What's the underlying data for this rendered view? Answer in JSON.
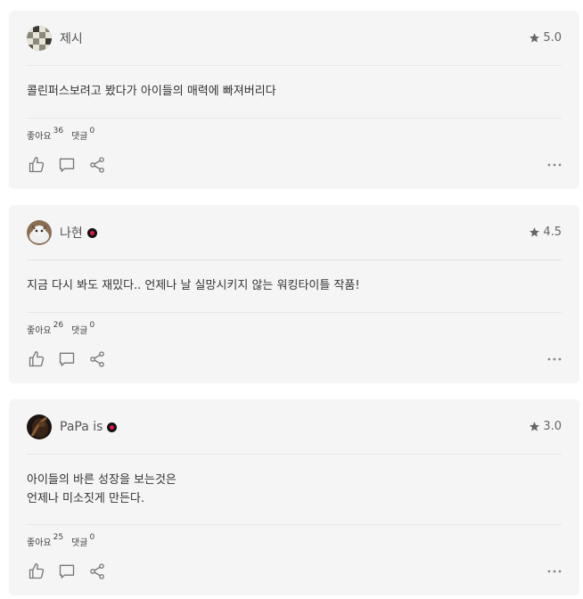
{
  "reviews": [
    {
      "user": "제시",
      "verified": false,
      "rating": "5.0",
      "comment": "콜린퍼스보려고 봤다가 아이들의 매력에 빠져버리다",
      "likes_label": "좋아요",
      "likes": "36",
      "comments_label": "댓글",
      "comments": "0",
      "avatar_icon": "checkered-avatar"
    },
    {
      "user": "나현",
      "verified": true,
      "rating": "4.5",
      "comment": "지금 다시 봐도 재밌다.. 언제나 날 실망시키지 않는 워킹타이틀 작품!",
      "likes_label": "좋아요",
      "likes": "26",
      "comments_label": "댓글",
      "comments": "0",
      "avatar_icon": "cat-avatar"
    },
    {
      "user": "PaPa is",
      "verified": true,
      "rating": "3.0",
      "comment": "아이들의 바른 성장을 보는것은\n언제나 미소짓게 만든다.",
      "likes_label": "좋아요",
      "likes": "25",
      "comments_label": "댓글",
      "comments": "0",
      "avatar_icon": "dark-photo-avatar"
    }
  ],
  "colors": {
    "card_bg": "#f5f5f5",
    "divider": "#e6e6e6",
    "badge_accent": "#e0174a",
    "icon": "#777777"
  }
}
